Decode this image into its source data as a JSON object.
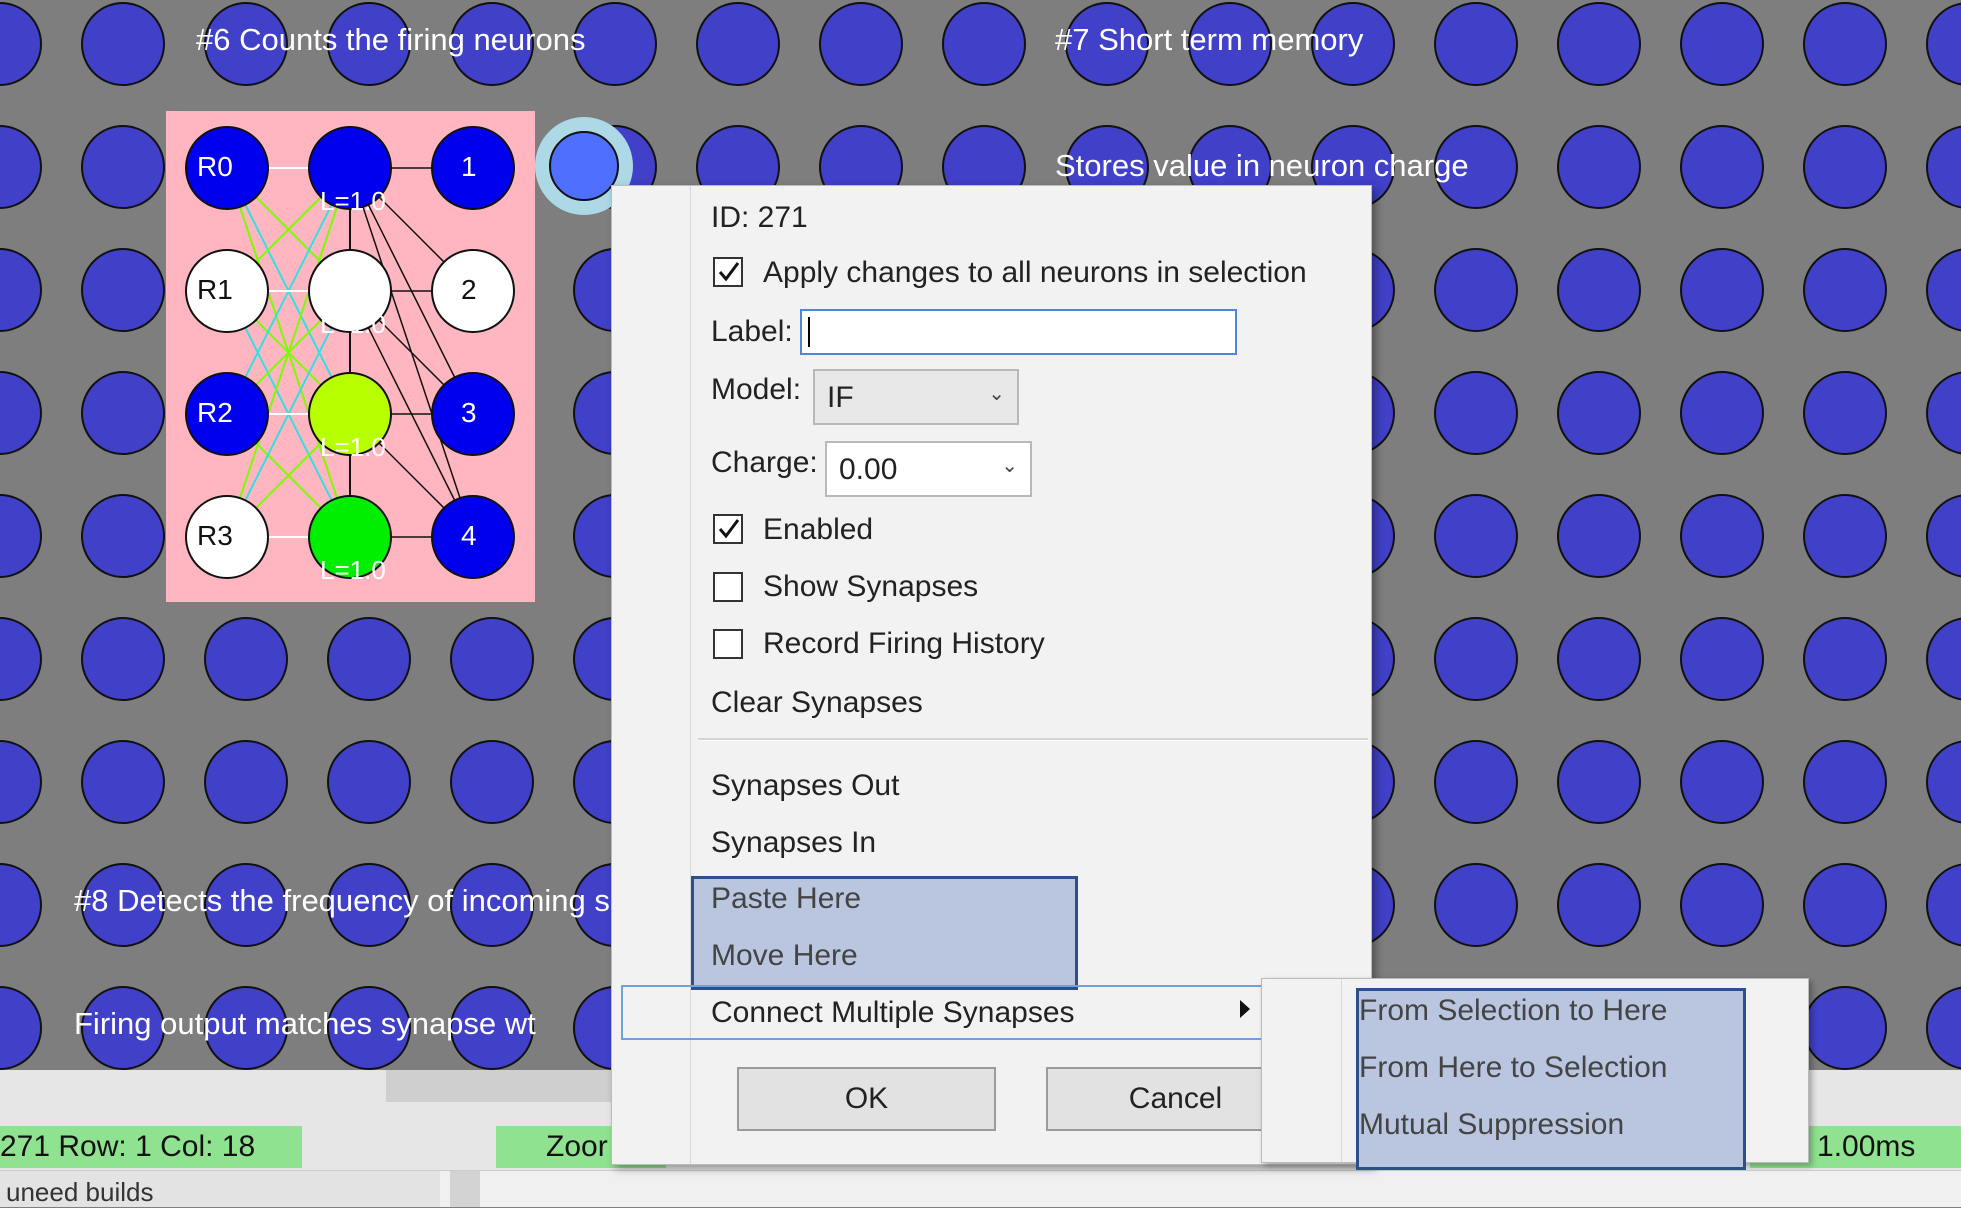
{
  "canvas": {
    "captions": {
      "c6": "#6 Counts the firing neurons",
      "c7": "#7 Short term memory",
      "c7b": "Stores value in neuron charge",
      "c8": "#8 Detects the frequency of incoming sp",
      "c8b": "Firing output matches synapse wt"
    },
    "neuron_labels": [
      "R0",
      "R1",
      "R2",
      "R3",
      "1",
      "2",
      "3",
      "4"
    ],
    "leak_labels": [
      "L=1.0",
      "L=1.0",
      "L=1.0",
      "L=1.0"
    ],
    "colors": {
      "background": "#7e7e7e",
      "neuron": "#4040c8",
      "pink": "#ffb6c1"
    }
  },
  "dialog": {
    "id_text": "ID: 271",
    "apply_all": {
      "label": "Apply changes to all neurons in selection",
      "checked": true
    },
    "label_field": {
      "label": "Label:",
      "value": ""
    },
    "model": {
      "label": "Model:",
      "value": "IF"
    },
    "charge": {
      "label": "Charge:",
      "value": "0.00"
    },
    "enabled": {
      "label": "Enabled",
      "checked": true
    },
    "show_synapses": {
      "label": "Show Synapses",
      "checked": false
    },
    "record_history": {
      "label": "Record Firing History",
      "checked": false
    },
    "clear_synapses": "Clear Synapses",
    "menu": {
      "synapses_out": "Synapses Out",
      "synapses_in": "Synapses In",
      "paste_here": "Paste Here",
      "move_here": "Move Here",
      "connect_multiple": "Connect Multiple Synapses"
    },
    "ok": "OK",
    "cancel": "Cancel"
  },
  "submenu": {
    "items": [
      "From Selection to Here",
      "From Here to Selection",
      "Mutual Suppression"
    ]
  },
  "statusbar": {
    "position": "271  Row: 1 Col: 18",
    "zoom": "Zoor",
    "timing": "d  1.00ms"
  },
  "bottom": {
    "left_text": "uneed builds"
  }
}
